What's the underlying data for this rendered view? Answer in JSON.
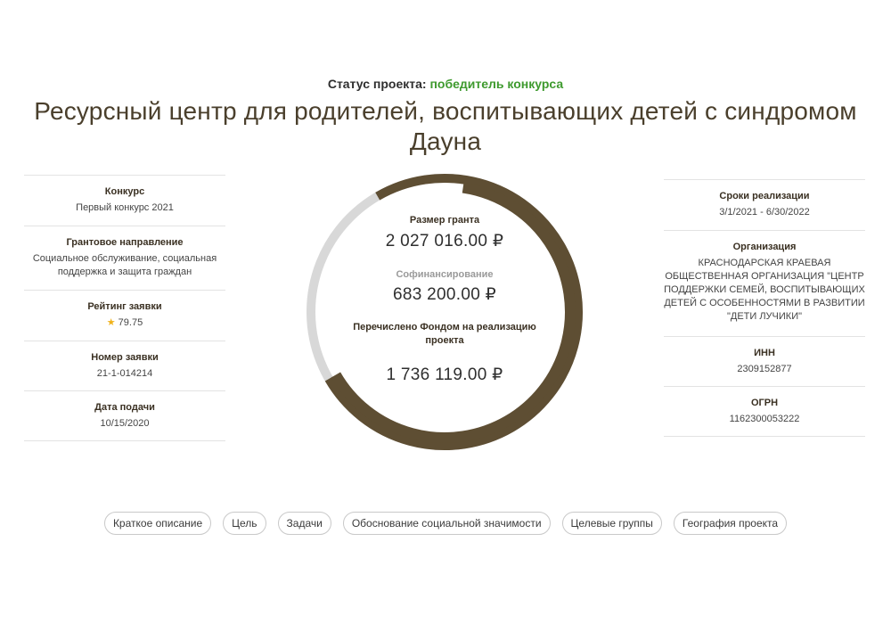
{
  "status": {
    "label": "Статус проекта:",
    "value": "победитель конкурса",
    "value_color": "#3e9a2e"
  },
  "title": "Ресурсный центр для родителей, воспитывающих детей с синдромом Дауна",
  "left": {
    "contest_label": "Конкурс",
    "contest_value": "Первый конкурс 2021",
    "direction_label": "Грантовое направление",
    "direction_value": "Социальное обслуживание, социальная поддержка и защита граждан",
    "rating_label": "Рейтинг заявки",
    "rating_icon": "star-icon",
    "rating_value": "79.75",
    "app_number_label": "Номер заявки",
    "app_number_value": "21-1-014214",
    "date_label": "Дата подачи",
    "date_value": "10/15/2020"
  },
  "right": {
    "period_label": "Сроки реализации",
    "period_value": "3/1/2021 - 6/30/2022",
    "org_label": "Организация",
    "org_value": "КРАСНОДАРСКАЯ КРАЕВАЯ ОБЩЕСТВЕННАЯ ОРГАНИЗАЦИЯ \"ЦЕНТР ПОДДЕРЖКИ СЕМЕЙ, ВОСПИТЫВАЮЩИХ ДЕТЕЙ С ОСОБЕННОСТЯМИ В РАЗВИТИИ \"ДЕТИ ЛУЧИКИ\"",
    "inn_label": "ИНН",
    "inn_value": "2309152877",
    "ogrn_label": "ОГРН",
    "ogrn_value": "1162300053222"
  },
  "ring": {
    "grant_label": "Размер гранта",
    "grant_value": "2 027 016.00 ₽",
    "cofin_label": "Софинансирование",
    "cofin_value": "683 200.00 ₽",
    "paid_label": "Перечислено Фондом на реализацию проекта",
    "paid_value": "1 736 119.00 ₽",
    "grant_fraction": 0.75,
    "paid_fraction": 0.643,
    "track_color": "#d8d8d8",
    "grant_color": "#5e4e33",
    "paid_color": "#5e4e33"
  },
  "tabs": [
    "Краткое описание",
    "Цель",
    "Задачи",
    "Обоснование социальной значимости",
    "Целевые группы",
    "География проекта"
  ]
}
